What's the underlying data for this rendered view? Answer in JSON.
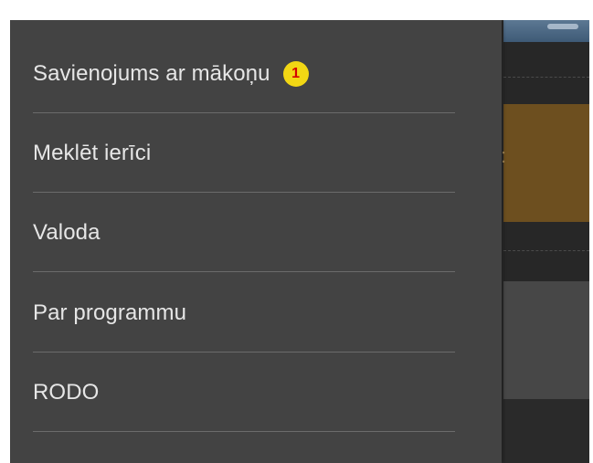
{
  "drawer": {
    "items": [
      {
        "label": "Savienojums ar mākoņu",
        "badge": "1"
      },
      {
        "label": "Meklēt ierīci"
      },
      {
        "label": "Valoda"
      },
      {
        "label": "Par programmu"
      },
      {
        "label": "RODO"
      }
    ]
  },
  "colors": {
    "drawer_background": "#434343",
    "divider": "#6b6b6b",
    "text": "#e6e6e6",
    "badge_background": "#f2d714",
    "badge_text": "#d40000"
  }
}
